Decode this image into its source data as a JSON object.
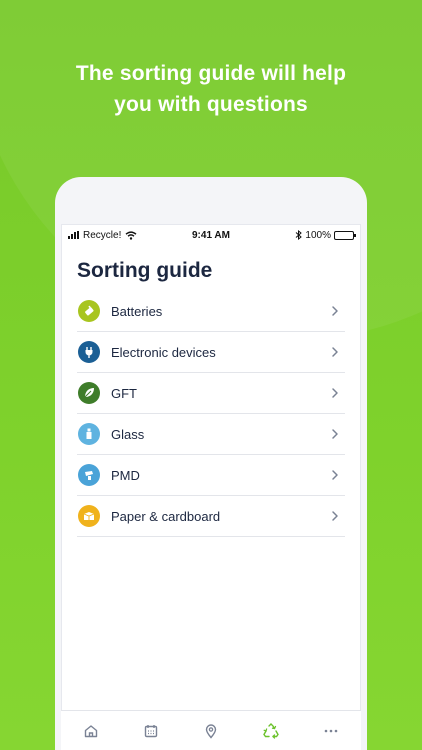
{
  "headline": {
    "line1": "The sorting guide will help",
    "line2": "you with questions"
  },
  "status_bar": {
    "carrier": "Recycle!",
    "time": "9:41 AM",
    "battery": "100%",
    "battery_level": 1.0
  },
  "page": {
    "title": "Sorting guide"
  },
  "categories": [
    {
      "label": "Batteries",
      "icon": "battery-icon",
      "color": "#a8c51f"
    },
    {
      "label": "Electronic devices",
      "icon": "plug-icon",
      "color": "#1b5f95"
    },
    {
      "label": "GFT",
      "icon": "leaf-icon",
      "color": "#3f7d2a"
    },
    {
      "label": "Glass",
      "icon": "glass-bottle-icon",
      "color": "#5fb3e0"
    },
    {
      "label": "PMD",
      "icon": "bottle-icon",
      "color": "#4aa3d8"
    },
    {
      "label": "Paper & cardboard",
      "icon": "box-icon",
      "color": "#f0b21c"
    }
  ],
  "tabbar": {
    "items": [
      "home-icon",
      "calendar-icon",
      "map-pin-icon",
      "recycle-icon",
      "more-icon"
    ],
    "active": "recycle-icon",
    "active_color": "#6cc22c",
    "inactive_color": "#7a8294"
  },
  "colors": {
    "background": "#7fcf2e",
    "title_text": "#1c2740"
  }
}
